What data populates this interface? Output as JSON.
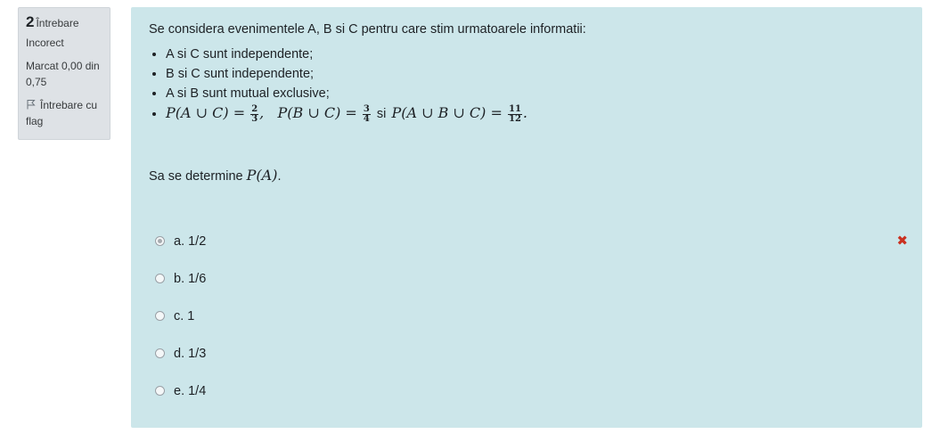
{
  "info": {
    "number": "2",
    "word": "Întrebare",
    "state": "Incorect",
    "grade": "Marcat 0,00 din 0,75",
    "flag_label": "Întrebare cu flag"
  },
  "question": {
    "intro": "Se considera evenimentele A, B si C pentru care stim urmatoarele informatii:",
    "bullets": [
      "A si C sunt independente;",
      "B si C sunt independente;",
      "A si B sunt mutual exclusive;"
    ],
    "formula": {
      "p_auc": "P(A ∪ C) = ",
      "f1_num": "2",
      "f1_den": "3",
      "p_buc": "P(B ∪ C) = ",
      "f2_num": "3",
      "f2_den": "4",
      "si": "si",
      "p_aubuc": "P(A ∪ B ∪ C) = ",
      "f3_num": "11",
      "f3_den": "12"
    },
    "task_text": "Sa se determine",
    "task_math": "P(A)",
    "task_end": "."
  },
  "answers": [
    {
      "label": "a. 1/2",
      "selected": true,
      "wrong": true
    },
    {
      "label": "b. 1/6",
      "selected": false
    },
    {
      "label": "c. 1",
      "selected": false
    },
    {
      "label": "d. 1/3",
      "selected": false
    },
    {
      "label": "e. 1/4",
      "selected": false
    }
  ],
  "wrong_mark": "✖",
  "colors": {
    "content_bg": "#cce6ea",
    "info_bg": "#dee2e6",
    "incorrect": "#ca3120"
  }
}
